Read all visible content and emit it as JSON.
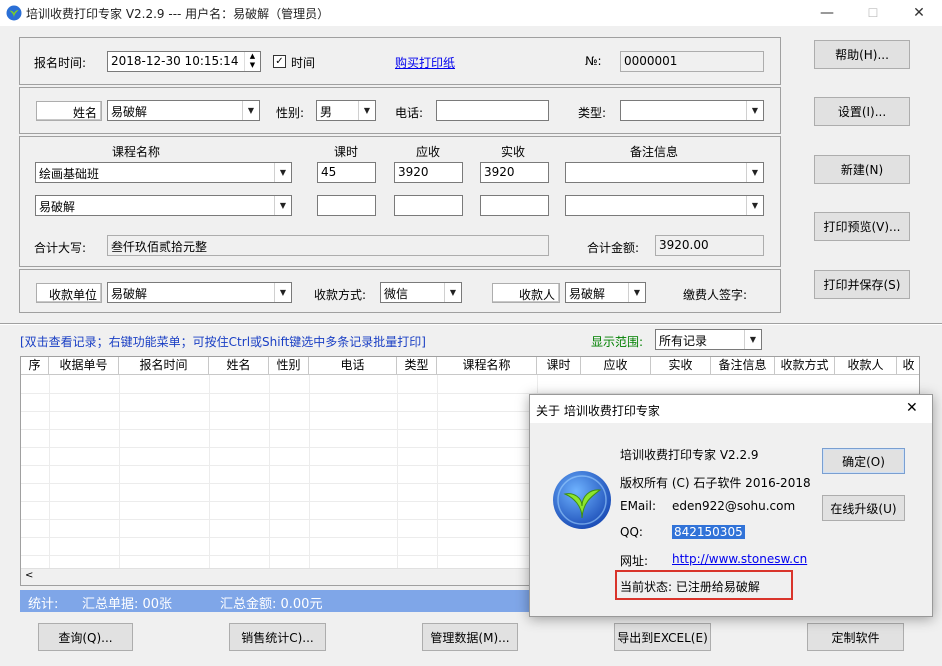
{
  "window": {
    "title": "培训收费打印专家 V2.2.9 --- 用户名：易破解（管理员）",
    "minimize": "—",
    "maximize": "☐",
    "close": "✕"
  },
  "header": {
    "reg_time_label": "报名时间:",
    "reg_time_value": "2018-12-30 10:15:14",
    "time_checkbox_label": "时间",
    "buy_paper_link": "购买打印纸",
    "no_label": "№:",
    "no_value": "0000001"
  },
  "student": {
    "name_btn": "姓名",
    "name_value": "易破解",
    "gender_label": "性别:",
    "gender_value": "男",
    "phone_label": "电话:",
    "phone_value": "",
    "type_label": "类型:",
    "type_value": ""
  },
  "course": {
    "col_name": "课程名称",
    "col_hours": "课时",
    "col_due": "应收",
    "col_paid": "实收",
    "col_notes": "备注信息",
    "row1": {
      "name": "绘画基础班",
      "hours": "45",
      "due": "3920",
      "paid": "3920",
      "notes": ""
    },
    "row2": {
      "name": "易破解",
      "hours": "",
      "due": "",
      "paid": "",
      "notes": ""
    },
    "total_words_label": "合计大写:",
    "total_words_value": "叁仟玖佰贰拾元整",
    "total_amount_label": "合计金额:",
    "total_amount_value": "3920.00"
  },
  "payment": {
    "unit_btn": "收款单位",
    "unit_value": "易破解",
    "method_label": "收款方式:",
    "method_value": "微信",
    "payee_btn": "收款人",
    "payee_value": "易破解",
    "signature_label": "缴费人签字:"
  },
  "side_buttons": {
    "help": "帮助(H)...",
    "settings": "设置(I)...",
    "new": "新建(N)",
    "preview": "打印预览(V)...",
    "print_save": "打印并保存(S)"
  },
  "records": {
    "hint": "[双击查看记录；右键功能菜单；可按住Ctrl或Shift键选中多条记录批量打印]",
    "range_label": "显示范围:",
    "range_value": "所有记录",
    "columns": [
      "序",
      "收据单号",
      "报名时间",
      "姓名",
      "性别",
      "电话",
      "类型",
      "课程名称",
      "课时",
      "应收",
      "实收",
      "备注信息",
      "收款方式",
      "收款人",
      "收"
    ],
    "status_stat": "统计:",
    "status_count": "汇总单据: 00张",
    "status_amount": "汇总金额: 0.00元"
  },
  "bottom_buttons": {
    "query": "查询(Q)...",
    "sales_stats": "销售统计C)...",
    "manage": "管理数据(M)...",
    "export": "导出到EXCEL(E)",
    "custom": "定制软件"
  },
  "about_dialog": {
    "title": "关于 培训收费打印专家",
    "close": "✕",
    "product": "培训收费打印专家 V2.2.9",
    "copyright": "版权所有 (C) 石子软件 2016-2018",
    "email_label": "EMail:",
    "email_value": "eden922@sohu.com",
    "qq_label": "QQ:",
    "qq_value": "842150305",
    "website_label": "网址:",
    "website_value": "http://www.stonesw.cn",
    "status": "当前状态: 已注册给易破解",
    "ok_button": "确定(O)",
    "upgrade_button": "在线升级(U)"
  },
  "colors": {
    "status_bar": "#7fa6e8",
    "hint_text": "#1a3fc4",
    "range_label": "#008000",
    "highlight_box": "#d9342b",
    "selection": "#3173d8"
  }
}
